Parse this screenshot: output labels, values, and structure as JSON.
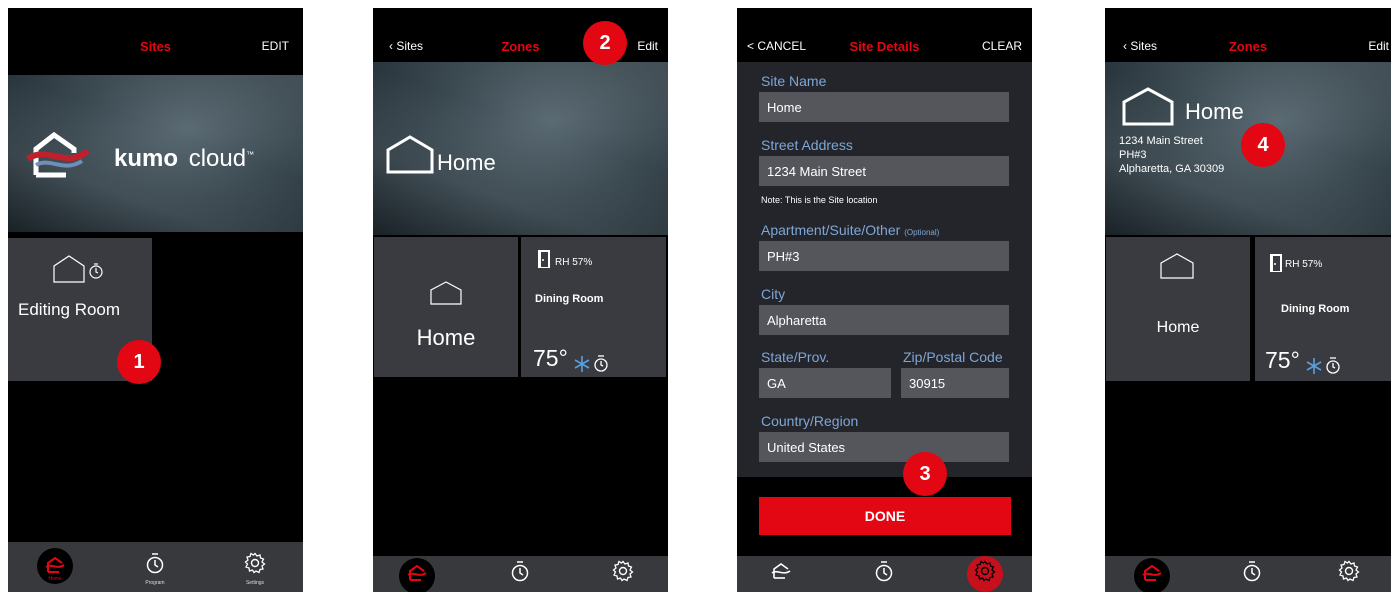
{
  "phone1": {
    "header": {
      "title": "Sites",
      "right": "EDIT"
    },
    "banner": {
      "brand_bold": "kumo",
      "brand_light": "cloud",
      "trademark": "™"
    },
    "tile": {
      "label": "Editing Room"
    },
    "badge": "1"
  },
  "phone2": {
    "header": {
      "back": "Sites",
      "title": "Zones",
      "right": "Edit"
    },
    "banner": {
      "site_name": "Home"
    },
    "tiles": {
      "home": {
        "label": "Home"
      },
      "dining": {
        "rh": "RH 57%",
        "name": "Dining Room",
        "temp": "75°"
      }
    },
    "badge": "2"
  },
  "phone3": {
    "header": {
      "left": "< CANCEL",
      "title": "Site Details",
      "right": "CLEAR"
    },
    "form": {
      "site_name": {
        "label": "Site Name",
        "value": "Home"
      },
      "street": {
        "label": "Street Address",
        "value": "1234 Main Street",
        "note": "Note: This is the Site location"
      },
      "apartment": {
        "label": "Apartment/Suite/Other",
        "optional": "(Optional)",
        "value": "PH#3"
      },
      "city": {
        "label": "City",
        "value": "Alpharetta"
      },
      "state": {
        "label": "State/Prov.",
        "value": "GA"
      },
      "zip": {
        "label": "Zip/Postal Code",
        "value": "30915"
      },
      "country": {
        "label": "Country/Region",
        "value": "United States"
      }
    },
    "done": "DONE",
    "badge": "3"
  },
  "phone4": {
    "header": {
      "back": "Sites",
      "title": "Zones",
      "right": "Edit"
    },
    "banner": {
      "site_name": "Home",
      "address1": "1234 Main Street",
      "address2": "PH#3",
      "address3": "Alpharetta, GA 30309"
    },
    "tiles": {
      "home": {
        "label": "Home"
      },
      "dining": {
        "rh": "RH 57%",
        "name": "Dining Room",
        "temp": "75°"
      }
    },
    "badge": "4"
  },
  "tabbar": {
    "home": "Home",
    "program": "Program",
    "settings": "Settings"
  },
  "colors": {
    "accent": "#e30613",
    "label_blue": "#7ea6d6",
    "tile": "#3a3b40",
    "snow": "#5a9fe0"
  }
}
